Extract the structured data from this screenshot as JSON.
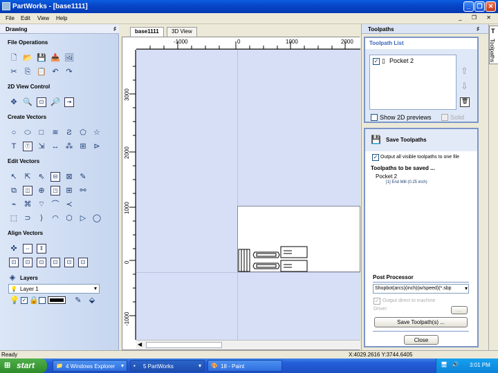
{
  "window": {
    "title": "PartWorks - [base1111]",
    "minimize": "_",
    "restore": "❐",
    "close": "✕"
  },
  "menubar": {
    "items": [
      "File",
      "Edit",
      "View",
      "Help"
    ],
    "mdi_controls": "_ ❐ ✕"
  },
  "left_panel": {
    "title": "Drawing",
    "pin": "♯",
    "sections": {
      "file_operations": "File Operations",
      "view_control": "2D View Control",
      "create_vectors": "Create Vectors",
      "edit_vectors": "Edit Vectors",
      "align_vectors": "Align Vectors",
      "layers": "Layers"
    },
    "layer_select_value": "Layer 1",
    "create_text_glyph": "T"
  },
  "document": {
    "tabs": [
      "base1111",
      "3D View"
    ],
    "ruler_h": [
      "-1000",
      "0",
      "1000",
      "2000"
    ],
    "ruler_v": [
      "3000",
      "2000",
      "1000",
      "0",
      "-1000"
    ],
    "scroll_left": "◀"
  },
  "right_panel": {
    "title": "Toolpaths",
    "pin": "♯",
    "toolpath_list": {
      "title": "Toolpath List",
      "items": [
        {
          "name": "Pocket 2",
          "checked": true
        }
      ],
      "show_2d_previews": "Show 2D previews",
      "solid": "Solid",
      "up": "⇧",
      "down": "⇩",
      "delete": "🗑"
    },
    "save_toolpaths": {
      "title": "Save Toolpaths",
      "output_all_label": "Output all visible toolpaths to one file",
      "to_be_saved_label": "Toolpaths to be saved ...",
      "saved_name": "Pocket 2",
      "saved_tool": "[1] End Mill (0.25 inch)",
      "post_processor_label": "Post Processor",
      "post_processor_value": "Shopbot(arcs)(inch)(w/speed)(*.sbp",
      "output_direct_label": "Output direct to machine",
      "driver_label": "Driver:",
      "driver_button": "...",
      "save_button": "Save Toolpath(s) ...",
      "close_button": "Close"
    }
  },
  "side_tab": {
    "label": "Toolpaths",
    "glyph": "T"
  },
  "statusbar": {
    "status": "Ready",
    "coords": "X:4029.2616 Y:3744.6405"
  },
  "taskbar": {
    "start": "start",
    "tasks": [
      "4 Windows Explorer",
      "5 PartWorks",
      "18 - Paint"
    ],
    "clock": "3:01 PM"
  }
}
